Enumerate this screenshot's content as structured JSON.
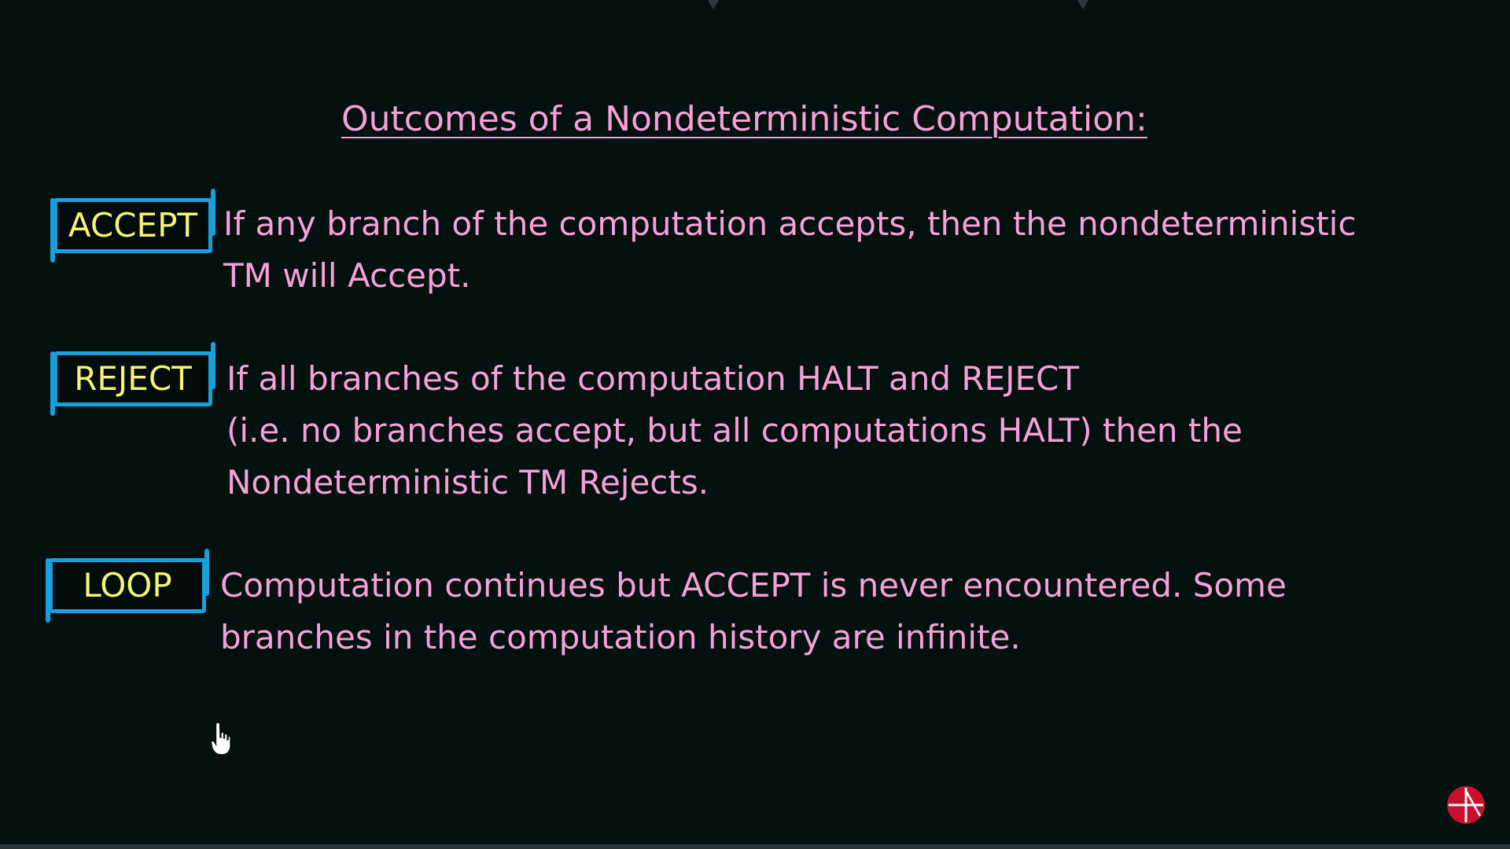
{
  "title": "Outcomes of a Nondeterministic Computation:",
  "outcomes": [
    {
      "label": "ACCEPT",
      "lines": [
        "If any branch of the computation accepts, then the nondeterministic",
        "TM will Accept."
      ]
    },
    {
      "label": "REJECT",
      "lines": [
        "If all branches of the computation HALT and REJECT",
        "(i.e. no branches accept, but all computations HALT) then the",
        "Nondeterministic TM Rejects."
      ]
    },
    {
      "label": "LOOP",
      "lines": [
        "Computation continues but ACCEPT is never encountered. Some",
        "branches in the computation history are infinite."
      ]
    }
  ],
  "icons": {
    "cursor": "hand-pointer-icon",
    "logo": "circle-arrow-logo-icon"
  },
  "colors": {
    "background": "#03110f",
    "text": "#f7a0d8",
    "label_text": "#f6f276",
    "label_border": "#1a9fdc",
    "logo": "#c8102e"
  }
}
